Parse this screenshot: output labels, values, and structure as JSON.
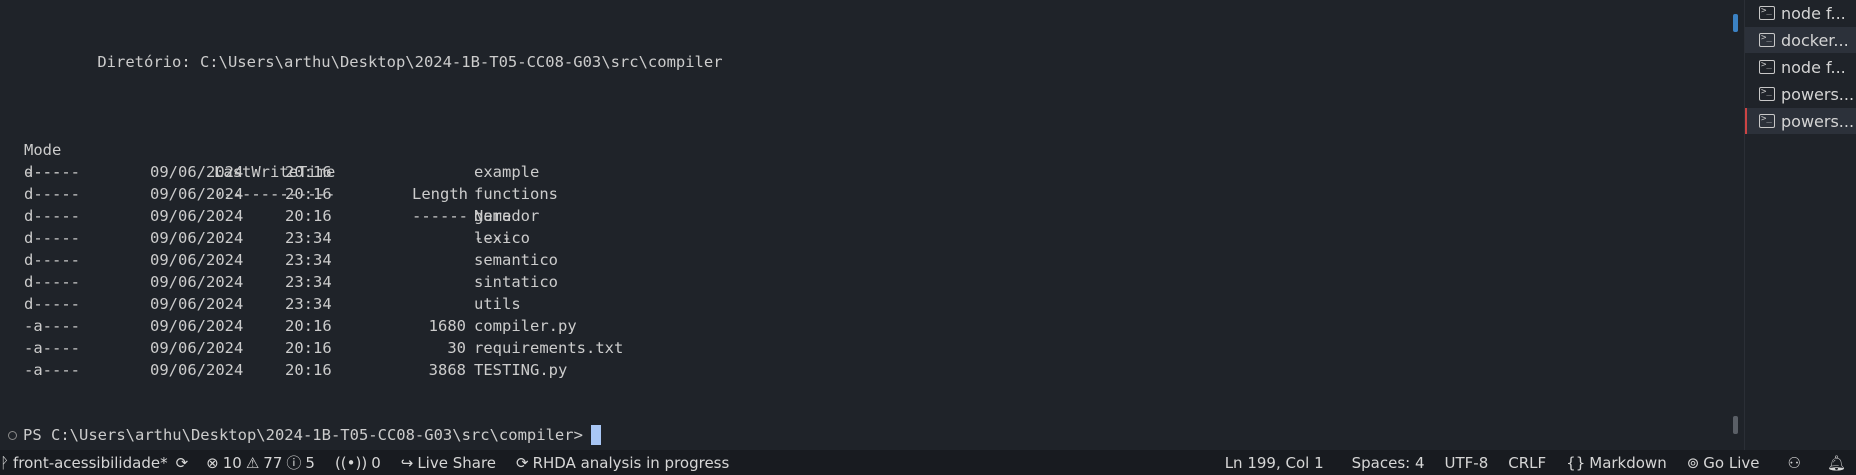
{
  "terminal": {
    "directory_line": "    Diretório: C:\\Users\\arthu\\Desktop\\2024-1B-T05-CC08-G03\\src\\compiler",
    "headers": {
      "mode": "Mode",
      "lastwritetime": "LastWriteTime",
      "length": "Length",
      "name": "Name"
    },
    "dashes": {
      "mode": "----",
      "lastwritetime": "-------------",
      "length": "------",
      "name": "----"
    },
    "rows": [
      {
        "mode": "d-----",
        "date": "09/06/2024",
        "time": "20:16",
        "length": "",
        "name": "example"
      },
      {
        "mode": "d-----",
        "date": "09/06/2024",
        "time": "20:16",
        "length": "",
        "name": "functions"
      },
      {
        "mode": "d-----",
        "date": "09/06/2024",
        "time": "20:16",
        "length": "",
        "name": "gerador"
      },
      {
        "mode": "d-----",
        "date": "09/06/2024",
        "time": "23:34",
        "length": "",
        "name": "lexico"
      },
      {
        "mode": "d-----",
        "date": "09/06/2024",
        "time": "23:34",
        "length": "",
        "name": "semantico"
      },
      {
        "mode": "d-----",
        "date": "09/06/2024",
        "time": "23:34",
        "length": "",
        "name": "sintatico"
      },
      {
        "mode": "d-----",
        "date": "09/06/2024",
        "time": "23:34",
        "length": "",
        "name": "utils"
      },
      {
        "mode": "-a----",
        "date": "09/06/2024",
        "time": "20:16",
        "length": "1680",
        "name": "compiler.py"
      },
      {
        "mode": "-a----",
        "date": "09/06/2024",
        "time": "20:16",
        "length": "30",
        "name": "requirements.txt"
      },
      {
        "mode": "-a----",
        "date": "09/06/2024",
        "time": "20:16",
        "length": "3868",
        "name": "TESTING.py"
      }
    ],
    "prompt": "PS C:\\Users\\arthu\\Desktop\\2024-1B-T05-CC08-G03\\src\\compiler>"
  },
  "terminal_tabs": [
    {
      "label": "node f...",
      "icon": "terminal-icon"
    },
    {
      "label": "docker...",
      "icon": "terminal-icon"
    },
    {
      "label": "node f...",
      "icon": "terminal-icon"
    },
    {
      "label": "powers...",
      "icon": "terminal-icon"
    },
    {
      "label": "powers...",
      "icon": "terminal-icon"
    }
  ],
  "statusbar": {
    "branch": "front-acessibilidade*",
    "errors": "10",
    "warnings": "77",
    "infos": "5",
    "ports": "0",
    "live_share": "Live Share",
    "rhda": "RHDA analysis in progress",
    "position": "Ln 199, Col 1",
    "spaces": "Spaces: 4",
    "encoding": "UTF-8",
    "eol": "CRLF",
    "language": "Markdown",
    "go_live": "Go Live"
  },
  "colors": {
    "background": "#1f2329",
    "statusbar": "#181b20",
    "cursor": "#a9c7f5",
    "scroll_accent": "#3b82c4"
  }
}
